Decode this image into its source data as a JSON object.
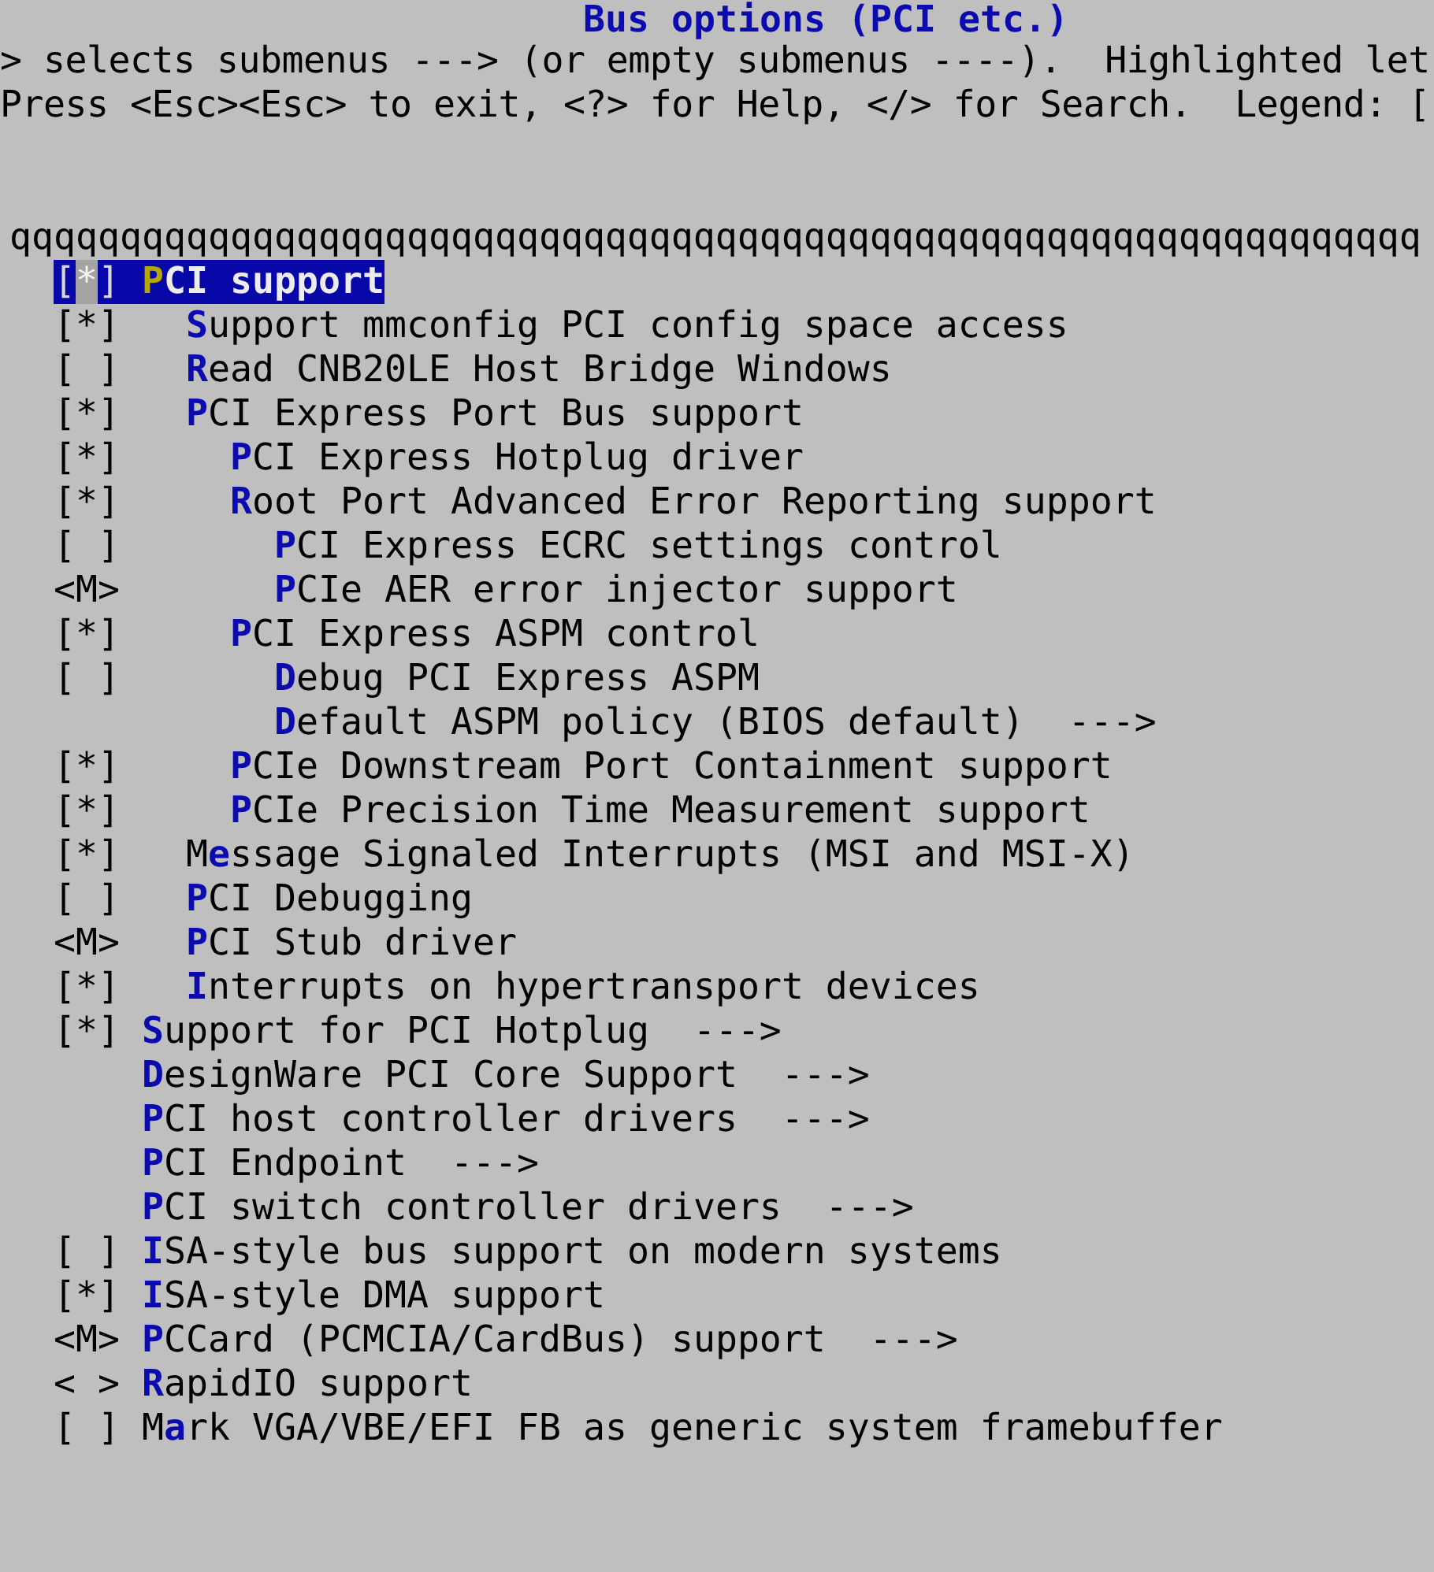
{
  "title": "Bus options (PCI etc.)",
  "help_lines": [
    "> selects submenus ---> (or empty submenus ----).  Highlighted let",
    "Press <Esc><Esc> to exit, <?> for Help, </> for Search.  Legend: ["
  ],
  "border_line": "qqqqqqqqqqqqqqqqqqqqqqqqqqqqqqqqqqqqqqqqqqqqqqqqqqqqqqqqqqqqqqqq",
  "items": [
    {
      "prompt": "[*]",
      "label": "**P**CI support",
      "selected": true,
      "children": [
        {
          "prompt": "[*]",
          "label": "**S**upport mmconfig PCI config space access",
          "selected": false
        },
        {
          "prompt": "[ ]",
          "label": "**R**ead CNB20LE Host Bridge Windows",
          "selected": false
        },
        {
          "prompt": "[*]",
          "label": "**P**CI Express Port Bus support",
          "selected": false,
          "children": [
            {
              "prompt": "[*]",
              "label": "**P**CI Express Hotplug driver",
              "selected": false
            },
            {
              "prompt": "[*]",
              "label": "**R**oot Port Advanced Error Reporting support",
              "selected": false,
              "children": [
                {
                  "prompt": "[ ]",
                  "label": "**P**CI Express ECRC settings control",
                  "selected": false
                },
                {
                  "prompt": "<M>",
                  "label": "**P**CIe AER error injector support",
                  "selected": false
                }
              ]
            },
            {
              "prompt": "[*]",
              "label": "**P**CI Express ASPM control",
              "selected": false,
              "children": [
                {
                  "prompt": "[ ]",
                  "label": "**D**ebug PCI Express ASPM",
                  "selected": false
                },
                {
                  "label": "**D**efault ASPM policy (BIOS default)  --->",
                  "selected": false
                }
              ]
            },
            {
              "prompt": "[*]",
              "label": "**P**CIe Downstream Port Containment support",
              "selected": false
            },
            {
              "prompt": "[*]",
              "label": "**P**CIe Precision Time Measurement support",
              "selected": false
            }
          ]
        },
        {
          "prompt": "[*]",
          "label": "M**e**ssage Signaled Interrupts (MSI and MSI-X)",
          "selected": false
        },
        {
          "prompt": "[ ]",
          "label": "**P**CI Debugging",
          "selected": false
        },
        {
          "prompt": "<M>",
          "label": "**P**CI Stub driver",
          "selected": false
        },
        {
          "prompt": "[*]",
          "label": "**I**nterrupts on hypertransport devices",
          "selected": false
        }
      ]
    },
    {
      "prompt": "[*]",
      "label": "**S**upport for PCI Hotplug  --->",
      "selected": false
    },
    {
      "label": "**D**esignWare PCI Core Support  --->",
      "selected": false
    },
    {
      "label": "**P**CI host controller drivers  --->",
      "selected": false
    },
    {
      "label": "**P**CI Endpoint  --->",
      "selected": false
    },
    {
      "label": "**P**CI switch controller drivers  --->",
      "selected": false
    },
    {
      "prompt": "[ ]",
      "label": "**I**SA-style bus support on modern systems",
      "selected": false
    },
    {
      "prompt": "[*]",
      "label": "**I**SA-style DMA support",
      "selected": false
    },
    {
      "prompt": "<M>",
      "label": "**P**CCard (PCMCIA/CardBus) support  --->",
      "selected": false
    },
    {
      "prompt": "< >",
      "label": "**R**apidIO support",
      "selected": false
    },
    {
      "prompt": "[ ]",
      "label": "M**a**rk VGA/VBE/EFI FB as generic system framebuffer",
      "selected": false
    }
  ]
}
